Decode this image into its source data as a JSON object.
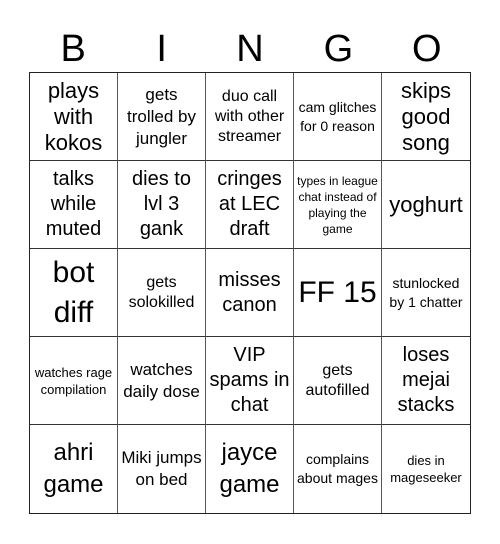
{
  "header": {
    "letters": [
      "B",
      "I",
      "N",
      "G",
      "O"
    ]
  },
  "cells": [
    "plays with kokos",
    "gets trolled by jungler",
    "duo call with other streamer",
    "cam glitches for 0 reason",
    "skips good song",
    "talks while muted",
    "dies to lvl 3 gank",
    "cringes at LEC draft",
    "types in league chat instead of playing the game",
    "yoghurt",
    "bot diff",
    "gets solokilled",
    "misses canon",
    "FF 15",
    "stunlocked by 1 chatter",
    "watches rage compilation",
    "watches daily dose",
    "VIP spams in chat",
    "gets autofilled",
    "loses mejai stacks",
    "ahri game",
    "Miki jumps on bed",
    "jayce game",
    "complains about mages",
    "dies in mageseeker"
  ]
}
